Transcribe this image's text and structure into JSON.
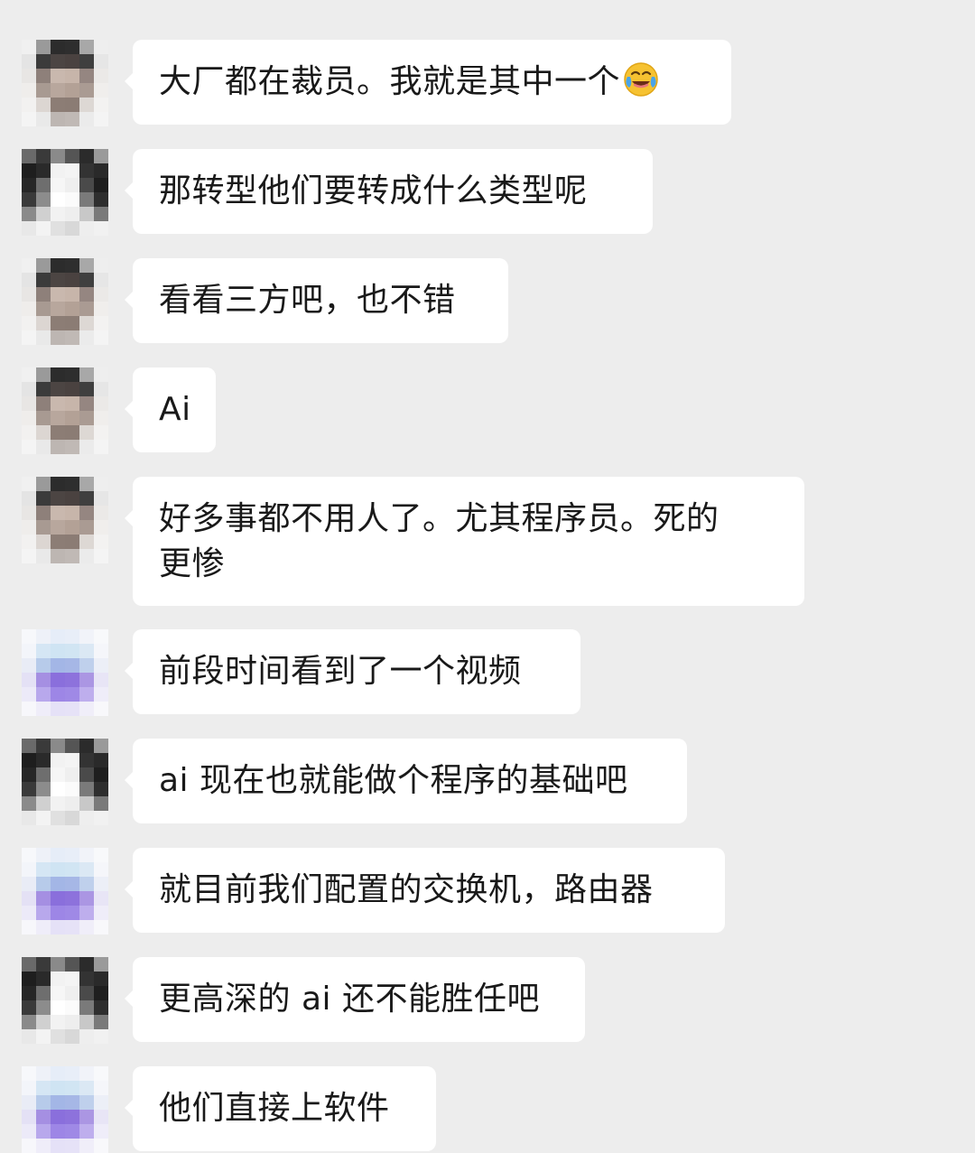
{
  "chat": {
    "messages": [
      {
        "sender": "contact-a",
        "text": "大厂都在裁员。我就是其中一个",
        "emoji": "face-with-tears-of-joy-icon"
      },
      {
        "sender": "contact-b",
        "text": "那转型他们要转成什么类型呢"
      },
      {
        "sender": "contact-a",
        "text": "看看三方吧，也不错"
      },
      {
        "sender": "contact-a",
        "text": "Ai"
      },
      {
        "sender": "contact-a",
        "text": "好多事都不用人了。尤其程序员。死的\n更惨"
      },
      {
        "sender": "contact-c",
        "text": "前段时间看到了一个视频"
      },
      {
        "sender": "contact-b",
        "text": "ai 现在也就能做个程序的基础吧"
      },
      {
        "sender": "contact-c",
        "text": "就目前我们配置的交换机，路由器"
      },
      {
        "sender": "contact-b",
        "text": "更高深的 ai 还不能胜任吧"
      },
      {
        "sender": "contact-c",
        "text": "他们直接上软件"
      }
    ]
  },
  "colors": {
    "background": "#ededed",
    "bubble": "#ffffff",
    "text": "#191919"
  }
}
